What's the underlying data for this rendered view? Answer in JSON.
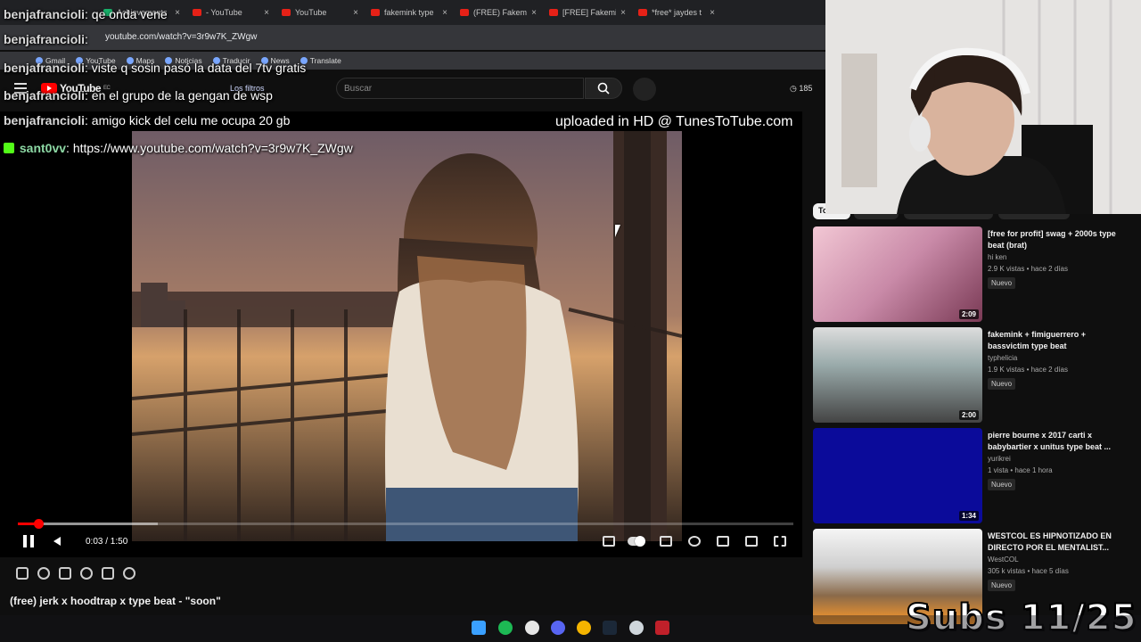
{
  "browser": {
    "tabs": [
      {
        "label": "Achievements",
        "icon": "kick-icon",
        "green": true
      },
      {
        "label": "- YouTube",
        "icon": "youtube-icon",
        "green": false
      },
      {
        "label": "YouTube",
        "icon": "youtube-icon",
        "green": false
      },
      {
        "label": "fakemink type",
        "icon": "youtube-icon",
        "green": false
      },
      {
        "label": "(FREE) Fakemi",
        "icon": "youtube-icon",
        "green": false
      },
      {
        "label": "[FREE] Fakemi",
        "icon": "youtube-icon",
        "green": false
      },
      {
        "label": "*free* jaydes t",
        "icon": "youtube-icon",
        "green": false
      }
    ],
    "url": "youtube.com/watch?v=3r9w7K_ZWgw",
    "bookmarks": [
      "Gmail",
      "YouTube",
      "Maps",
      "Noticias",
      "Traducir",
      "News",
      "Translate"
    ]
  },
  "youtube": {
    "logo_text": "YouTube",
    "region": "EC",
    "filters_label": "Los filtros",
    "search_placeholder": "Buscar",
    "views_count": "185"
  },
  "chat": [
    {
      "user": "benjafrancioli",
      "message": ": qe onda vene"
    },
    {
      "user": "benjafrancioli",
      "message": ":"
    },
    {
      "user": "benjafrancioli",
      "message": ": viste q sosin pasó la data del 7tv gratis"
    },
    {
      "user": "benjafrancioli",
      "message": ": en el grupo de la gengan de wsp"
    },
    {
      "user": "benjafrancioli",
      "message": ": amigo kick del celu me ocupa 20 gb"
    },
    {
      "user": "sant0vv",
      "message": ": https://www.youtube.com/watch?v=3r9w7K_ZWgw"
    }
  ],
  "player": {
    "watermark": "uploaded in HD @ TunesToTube.com",
    "current_time": "0:03",
    "duration": "1:50",
    "time_label": "0:03 / 1:50",
    "progress_fraction": 0.027,
    "buffer_fraction": 0.18,
    "accent": "#ff0000"
  },
  "video_title": "(free) jerk x hoodtrap x type beat - \"soon\"",
  "sidebar": {
    "chip_label": "Todos",
    "recommendations": [
      {
        "title": "[free for profit] swag + 2000s type beat (brat)",
        "channel": "hi ken",
        "meta": "2.9 K vistas • hace 2 días",
        "badge": "Nuevo",
        "duration": "2:09"
      },
      {
        "title": "fakemink + fimiguerrero + bassvictim type beat",
        "channel": "typhelicia",
        "meta": "1.9 K vistas • hace 2 días",
        "badge": "Nuevo",
        "duration": "2:00"
      },
      {
        "title": "pierre bourne x 2017 carti x babybartier x unitus type beat ...",
        "channel": "yurikrei",
        "meta": "1 vista • hace 1 hora",
        "badge": "Nuevo",
        "duration": "1:34"
      },
      {
        "title": "WESTCOL ES HIPNOTIZADO EN DIRECTO POR EL MENTALIST...",
        "channel": "WestCOL",
        "meta": "305 k vistas • hace 5 días",
        "badge": "Nuevo",
        "duration": ""
      }
    ]
  },
  "overlay": {
    "subs_text": "Subs 11/25"
  }
}
